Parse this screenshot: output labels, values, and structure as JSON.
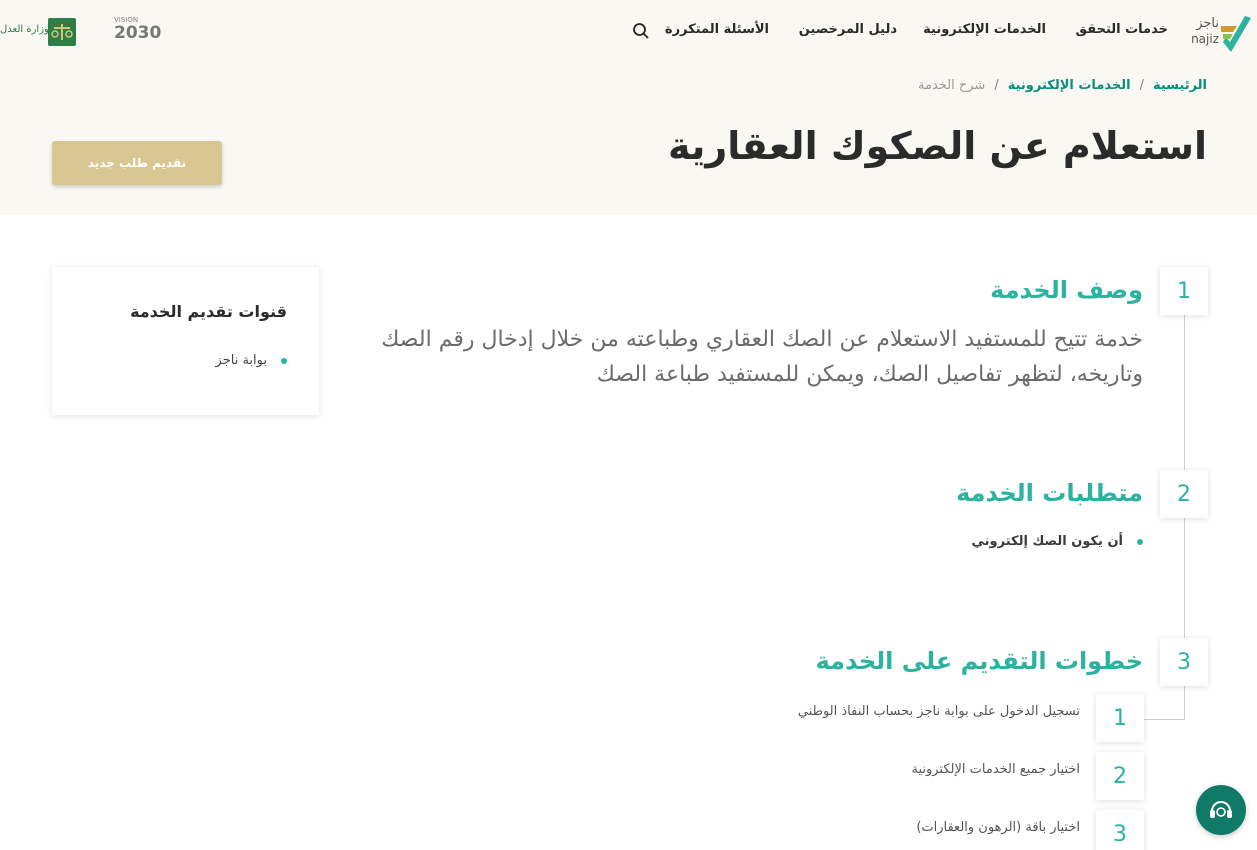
{
  "nav": {
    "logo_text_ar": "ناجز",
    "logo_text_en": "najiz",
    "items": [
      "خدمات التحقق",
      "الخدمات الإلكترونية",
      "دليل المرخصين",
      "الأسئلة المتكررة"
    ],
    "vision_label": "VISION",
    "vision_year": "2030",
    "moj_label": "وزارة العدل"
  },
  "breadcrumb": {
    "home": "الرئيسية",
    "eservices": "الخدمات الإلكترونية",
    "current": "شرح الخدمة",
    "separator": "/"
  },
  "page": {
    "title": "استعلام عن الصكوك العقارية",
    "new_request_button": "تقديم طلب جديد"
  },
  "sections": [
    {
      "number": "1",
      "title": "وصف الخدمة",
      "description": "خدمة تتيح للمستفيد الاستعلام عن الصك العقاري وطباعته من خلال إدخال رقم الصك وتاريخه، لتظهر تفاصيل الصك، ويمكن للمستفيد طباعة الصك"
    },
    {
      "number": "2",
      "title": "متطلبات الخدمة",
      "requirements": [
        "أن يكون الصك إلكتروني"
      ]
    },
    {
      "number": "3",
      "title": "خطوات التقديم على الخدمة",
      "steps": [
        {
          "number": "1",
          "text": "تسجيل الدخول على بوابة ناجز بحساب النفاذ الوطني"
        },
        {
          "number": "2",
          "text": "اختيار جميع الخدمات الإلكترونية"
        },
        {
          "number": "3",
          "text": "اختيار باقة (الرهون والعقارات)"
        }
      ]
    }
  ],
  "channels": {
    "title": "قنوات تقديم الخدمة",
    "items": [
      "بوابة ناجز"
    ]
  },
  "colors": {
    "accent": "#2bb3a0",
    "gold": "#d9c793",
    "header_bg": "#faf8f3",
    "chat_bg": "#0f7a68"
  }
}
